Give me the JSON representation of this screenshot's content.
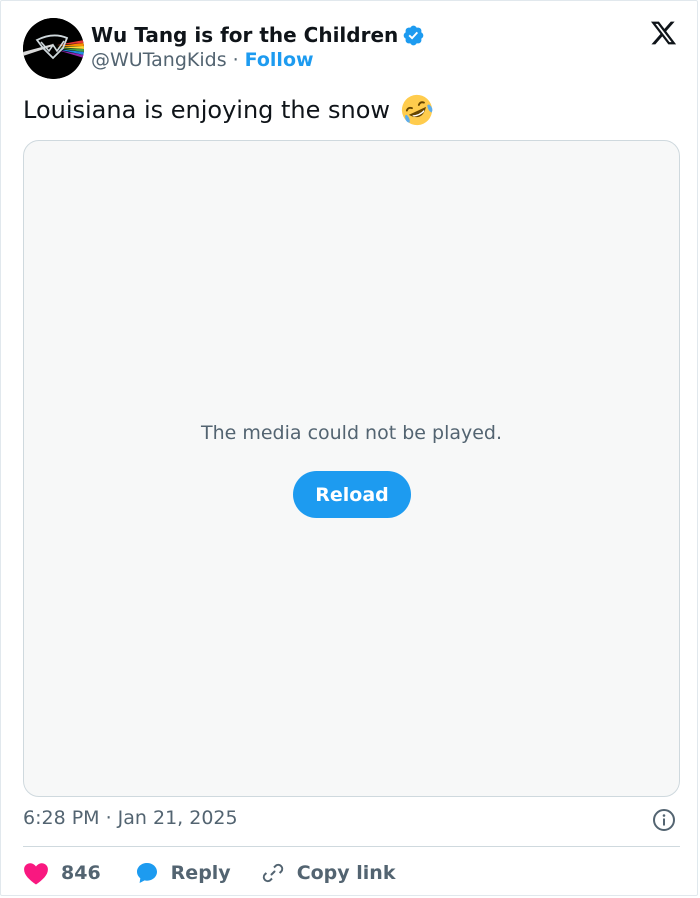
{
  "author": {
    "name": "Wu Tang is for the Children",
    "handle": "@WUTangKids",
    "separator": "·",
    "follow_label": "Follow"
  },
  "tweet": {
    "text": "Louisiana is enjoying the snow",
    "emoji": "rolling-on-the-floor-laughing-icon"
  },
  "media": {
    "message": "The media could not be played.",
    "reload_label": "Reload"
  },
  "timestamp": "6:28 PM · Jan 21, 2025",
  "actions": {
    "likes": "846",
    "reply_label": "Reply",
    "copy_label": "Copy link"
  },
  "colors": {
    "accent": "#1d9bf0",
    "like": "#f91880",
    "text_secondary": "#536471"
  }
}
